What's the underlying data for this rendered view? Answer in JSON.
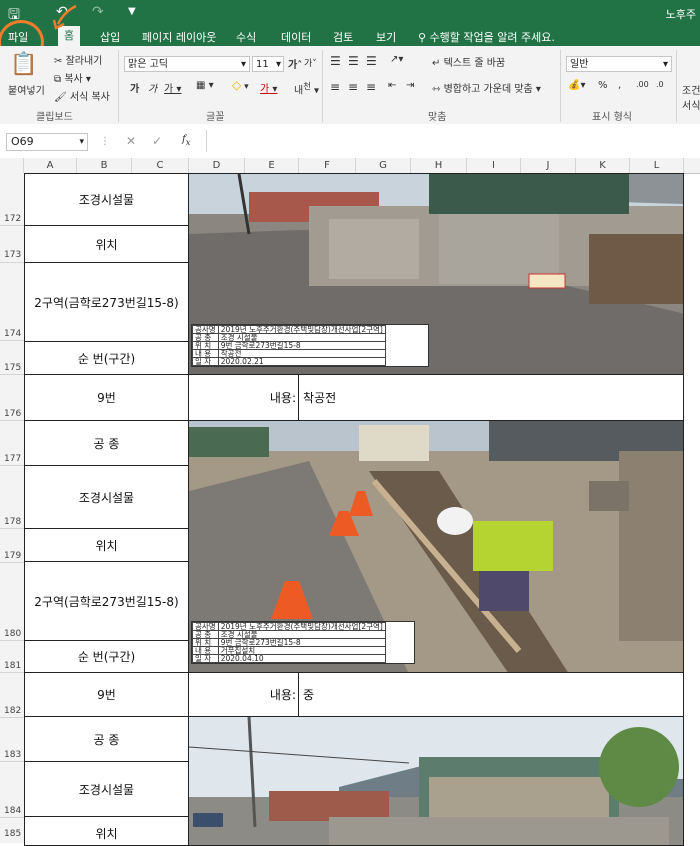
{
  "window": {
    "title": "노후주"
  },
  "tabs": [
    {
      "label": "파일"
    },
    {
      "label": "홈"
    },
    {
      "label": "삽입"
    },
    {
      "label": "페이지 레이아웃"
    },
    {
      "label": "수식"
    },
    {
      "label": "데이터"
    },
    {
      "label": "검토"
    },
    {
      "label": "보기"
    },
    {
      "label": "수행할 작업을 알려 주세요."
    }
  ],
  "ribbon": {
    "paste": "붙여넣기",
    "cut": "잘라내기",
    "copy": "복사",
    "format_painter": "서식 복사",
    "clipboard_group": "클립보드",
    "font_name": "맑은 고딕",
    "font_size": "11",
    "font_group": "글꼴",
    "wrap_text": "텍스트 줄 바꿈",
    "merge_center": "병합하고 가운데 맞춤",
    "align_group": "맞춤",
    "number_format": "일반",
    "number_group": "표시 형식",
    "conditional": "조건",
    "conditional2": "서식"
  },
  "formula_bar": {
    "name_box": "O69",
    "formula": ""
  },
  "columns": [
    "A",
    "B",
    "C",
    "D",
    "E",
    "F",
    "G",
    "H",
    "I",
    "J",
    "K",
    "L"
  ],
  "rows": [
    "172",
    "173",
    "174",
    "175",
    "176",
    "177",
    "178",
    "179",
    "180",
    "181",
    "182",
    "183",
    "184",
    "185"
  ],
  "sections": [
    {
      "labels": {
        "type": "조경시설물",
        "pos_label": "위치",
        "location": "2구역(금학로273번길15-8)",
        "seq_label": "순  번(구간)",
        "seq": "9번",
        "content_label": "내용:",
        "content": "착공전"
      },
      "caption": {
        "project_label": "공사명",
        "project": "2019년 노후주거환경(주택및담장)개선사업[2구역]",
        "work_label": "공 종",
        "work": "조경 시설물",
        "loc_label": "위 치",
        "loc": "9번 금학로273번길15-8",
        "desc_label": "내 용",
        "desc": "착공전",
        "date_label": "일 자",
        "date": "2020.02.21"
      }
    },
    {
      "labels": {
        "work_type": "공      종",
        "type": "조경시설물",
        "pos_label": "위치",
        "location": "2구역(금학로273번길15-8)",
        "seq_label": "순  번(구간)",
        "seq": "9번",
        "content_label": "내용:",
        "content": "중"
      },
      "caption": {
        "project_label": "공사명",
        "project": "2019년 노후주거환경(주택및담장)개선사업[2구역]",
        "work_label": "공 종",
        "work": "조경 시설물",
        "loc_label": "위 치",
        "loc": "9번 금학로273번길15-8",
        "desc_label": "내 용",
        "desc": "거푸집설치",
        "date_label": "일 자",
        "date": "2020.04.10"
      }
    },
    {
      "labels": {
        "work_type": "공      종",
        "type": "조경시설물",
        "pos_label": "위치"
      }
    }
  ]
}
